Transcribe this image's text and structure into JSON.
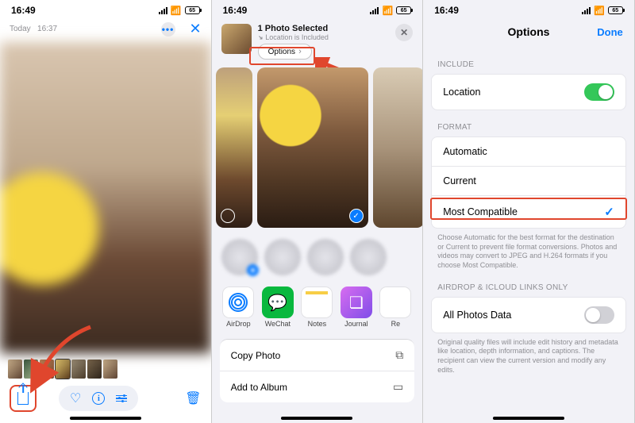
{
  "status": {
    "time": "16:49",
    "battery": "65"
  },
  "screen1": {
    "date": "Today",
    "timestamp": "16:37",
    "toolbar": {
      "share": "Share",
      "favorite": "Favorite",
      "info": "Info",
      "adjust": "Adjust",
      "delete": "Delete"
    }
  },
  "screen2": {
    "selected_title": "1 Photo Selected",
    "location_note": "Location is Included",
    "options_label": "Options",
    "apps": {
      "airdrop": "AirDrop",
      "wechat": "WeChat",
      "notes": "Notes",
      "journal": "Journal",
      "more": "Re"
    },
    "actions": {
      "copy": "Copy Photo",
      "add_album": "Add to Album"
    }
  },
  "screen3": {
    "title": "Options",
    "done": "Done",
    "include_label": "INCLUDE",
    "location_label": "Location",
    "format_label": "FORMAT",
    "format_auto": "Automatic",
    "format_current": "Current",
    "format_most": "Most Compatible",
    "format_note": "Choose Automatic for the best format for the destination or Current to prevent file format conversions. Photos and videos may convert to JPEG and H.264 formats if you choose Most Compatible.",
    "airdrop_label": "AIRDROP & ICLOUD LINKS ONLY",
    "all_photos_data": "All Photos Data",
    "airdrop_note": "Original quality files will include edit history and metadata like location, depth information, and captions. The recipient can view the current version and modify any edits."
  }
}
